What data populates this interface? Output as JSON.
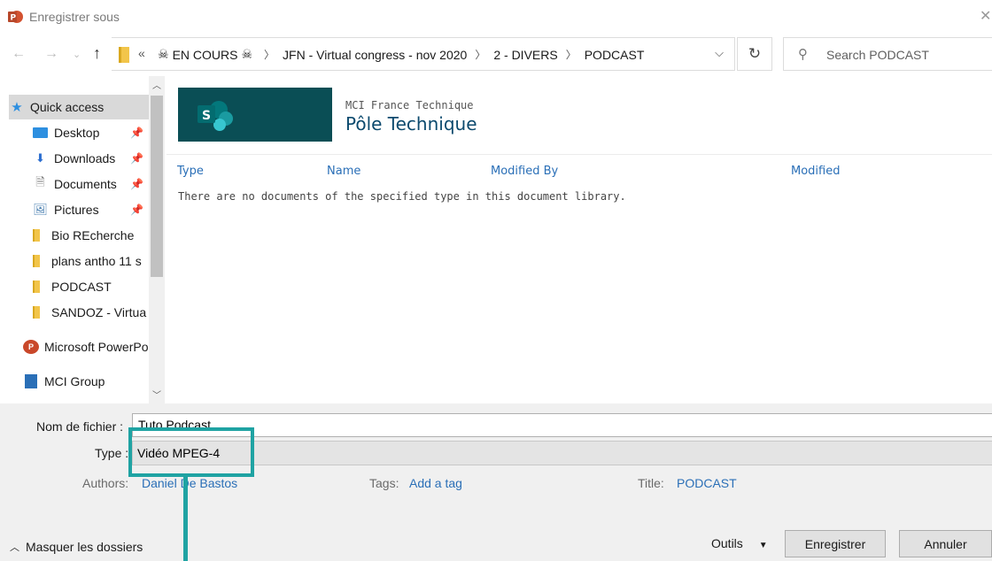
{
  "window": {
    "title": "Enregistrer sous"
  },
  "address": {
    "root_chevron": "«",
    "crumbs": [
      "EN COURS",
      "JFN - Virtual congress - nov 2020",
      "2 - DIVERS",
      "PODCAST"
    ],
    "skull_glyph": "☠"
  },
  "search": {
    "placeholder": "Search PODCAST"
  },
  "sidebar": {
    "items": [
      {
        "label": "Quick access",
        "icon": "star-icon"
      },
      {
        "label": "Desktop",
        "icon": "desktop-icon"
      },
      {
        "label": "Downloads",
        "icon": "download-icon"
      },
      {
        "label": "Documents",
        "icon": "documents-icon"
      },
      {
        "label": "Pictures",
        "icon": "pictures-icon"
      },
      {
        "label": "Bio REcherche",
        "icon": "folder-icon"
      },
      {
        "label": "plans antho 11 s",
        "icon": "folder-icon"
      },
      {
        "label": "PODCAST",
        "icon": "folder-icon"
      },
      {
        "label": "SANDOZ - Virtua",
        "icon": "folder-icon"
      },
      {
        "label": "Microsoft PowerPo",
        "icon": "powerpoint-icon"
      },
      {
        "label": "MCI Group",
        "icon": "building-icon"
      }
    ]
  },
  "library": {
    "org": "MCI France Technique",
    "site_title": "Pôle Technique",
    "columns": [
      "Type",
      "Name",
      "Modified By",
      "Modified"
    ],
    "empty_message": "There are no documents of the specified type in this document library."
  },
  "form": {
    "filename_label": "Nom de fichier :",
    "filename_value": "Tuto Podcast",
    "type_label": "Type :",
    "type_value": "Vidéo MPEG-4",
    "authors_label": "Authors:",
    "authors_value": "Daniel De Bastos",
    "tags_label": "Tags:",
    "tags_value": "Add a tag",
    "title_label": "Title:",
    "title_value": "PODCAST"
  },
  "footer": {
    "toggle_folders": "Masquer les dossiers",
    "tools": "Outils",
    "save": "Enregistrer",
    "cancel": "Annuler"
  },
  "colors": {
    "annotation": "#1fa3a3",
    "sharepoint_tile": "#0a4e55",
    "link": "#2a6fb7"
  }
}
